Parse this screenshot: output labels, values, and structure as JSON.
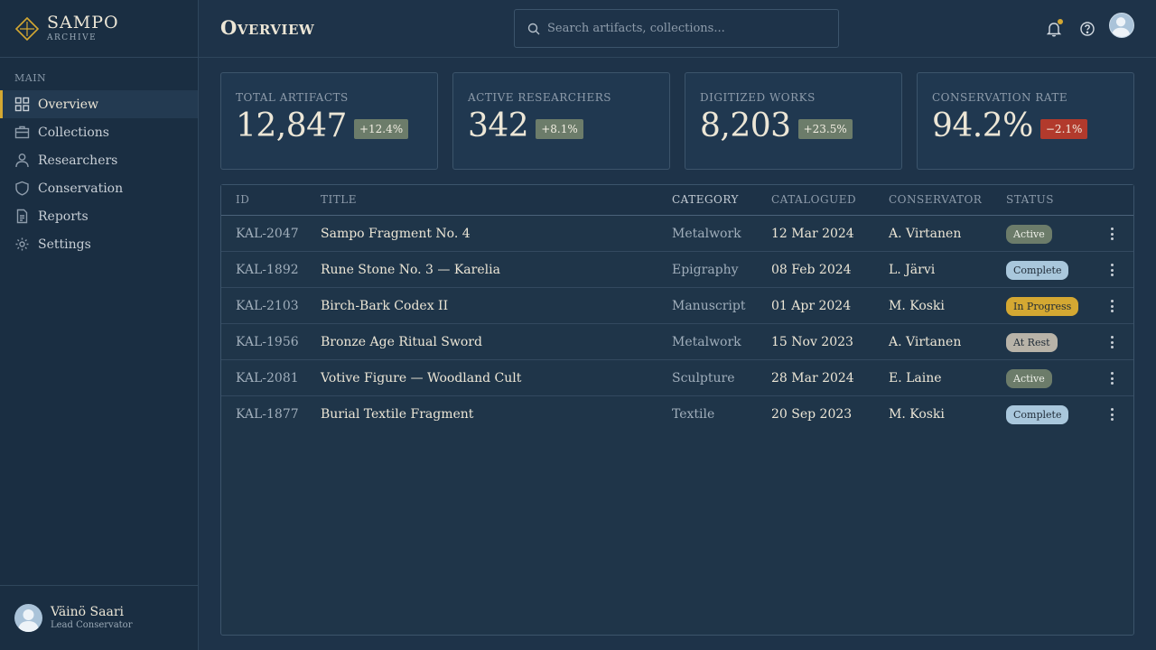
{
  "brand": {
    "name": "SAMPO",
    "subtitle": "ARCHIVE"
  },
  "sidebar": {
    "section_label": "MAIN",
    "items": [
      {
        "label": "Overview",
        "icon": "grid-icon",
        "active": true
      },
      {
        "label": "Collections",
        "icon": "briefcase-icon",
        "active": false
      },
      {
        "label": "Researchers",
        "icon": "person-icon",
        "active": false
      },
      {
        "label": "Conservation",
        "icon": "shield-icon",
        "active": false
      },
      {
        "label": "Reports",
        "icon": "document-icon",
        "active": false
      },
      {
        "label": "Settings",
        "icon": "gear-icon",
        "active": false
      }
    ]
  },
  "user": {
    "name": "Väinö Saari",
    "role": "Lead Conservator"
  },
  "header": {
    "title": "Overview",
    "search_placeholder": "Search artifacts, collections..."
  },
  "stats": [
    {
      "label": "Total Artifacts",
      "value": "12,847",
      "delta": "+12.4%",
      "trend": "up"
    },
    {
      "label": "Active Researchers",
      "value": "342",
      "delta": "+8.1%",
      "trend": "up"
    },
    {
      "label": "Digitized Works",
      "value": "8,203",
      "delta": "+23.5%",
      "trend": "up"
    },
    {
      "label": "Conservation Rate",
      "value": "94.2%",
      "delta": "−2.1%",
      "trend": "down"
    }
  ],
  "table": {
    "columns": [
      "ID",
      "Title",
      "Category",
      "Catalogued",
      "Conservator",
      "Status"
    ],
    "rows": [
      {
        "id": "KAL-2047",
        "title": "Sampo Fragment No. 4",
        "category": "Metalwork",
        "date": "12 Mar 2024",
        "conservator": "A. Virtanen",
        "status": "Active"
      },
      {
        "id": "KAL-1892",
        "title": "Rune Stone No. 3 — Karelia",
        "category": "Epigraphy",
        "date": "08 Feb 2024",
        "conservator": "L. Järvi",
        "status": "Complete"
      },
      {
        "id": "KAL-2103",
        "title": "Birch-Bark Codex II",
        "category": "Manuscript",
        "date": "01 Apr 2024",
        "conservator": "M. Koski",
        "status": "In Progress"
      },
      {
        "id": "KAL-1956",
        "title": "Bronze Age Ritual Sword",
        "category": "Metalwork",
        "date": "15 Nov 2023",
        "conservator": "A. Virtanen",
        "status": "At Rest"
      },
      {
        "id": "KAL-2081",
        "title": "Votive Figure — Woodland Cult",
        "category": "Sculpture",
        "date": "28 Mar 2024",
        "conservator": "E. Laine",
        "status": "Active"
      },
      {
        "id": "KAL-1877",
        "title": "Burial Textile Fragment",
        "category": "Textile",
        "date": "20 Sep 2023",
        "conservator": "M. Koski",
        "status": "Complete"
      }
    ]
  },
  "colors": {
    "accent": "#d4a832",
    "status_active": "#6c7c6a",
    "status_complete": "#a9c7dc",
    "status_in_progress": "#d4a832",
    "status_at_rest": "#b8b3a8",
    "delta_up": "#6c7c6a",
    "delta_down": "#b23a2c"
  }
}
